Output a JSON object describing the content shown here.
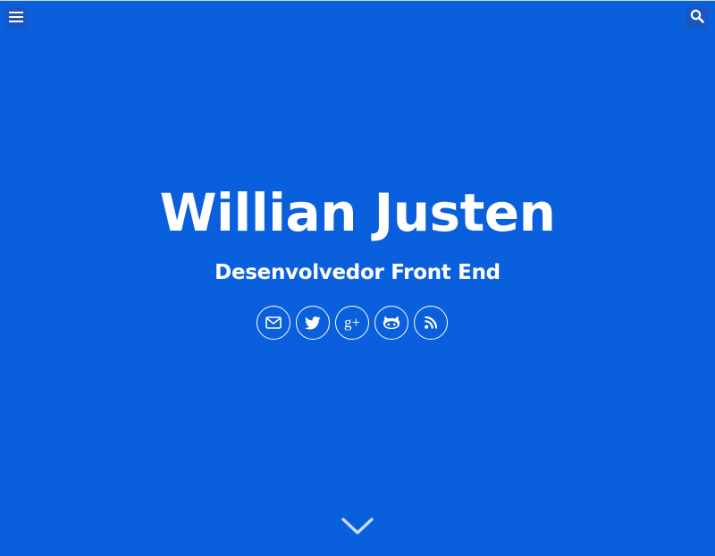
{
  "header": {
    "menu_icon": "hamburger-menu-icon",
    "search_icon": "search-icon"
  },
  "hero": {
    "name": "Willian Justen",
    "role": "Desenvolvedor Front End"
  },
  "social": [
    {
      "icon": "mail-icon"
    },
    {
      "icon": "twitter-icon"
    },
    {
      "icon": "google-plus-icon",
      "glyph": "g+"
    },
    {
      "icon": "github-icon"
    },
    {
      "icon": "rss-icon"
    }
  ],
  "scroll": {
    "icon": "chevron-down-icon"
  },
  "colors": {
    "background": "#0a5fdc",
    "button_bg": "#1a55c2",
    "foreground": "#ffffff"
  }
}
